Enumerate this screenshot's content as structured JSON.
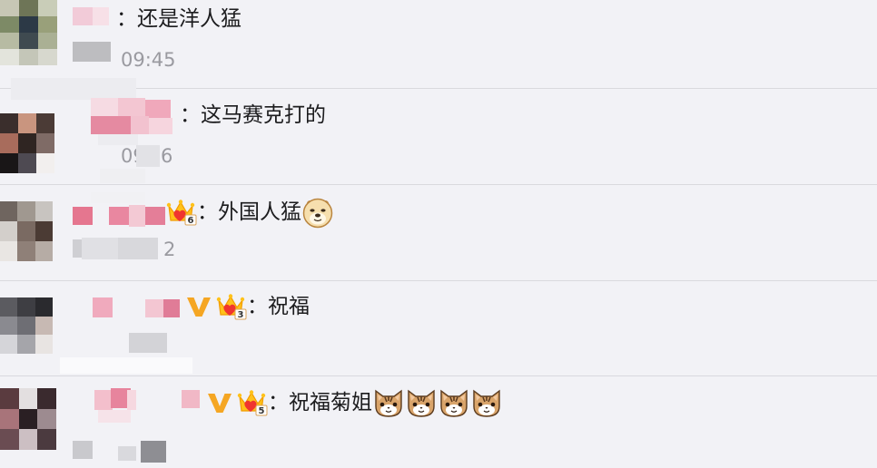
{
  "page": {
    "background": "#f2f2f6"
  },
  "colors": {
    "text": "#1c1c1e",
    "timestamp": "#9a9aa0",
    "divider": "#d9d9de",
    "verified_badge": "#f5a623",
    "fan_badge_crown": "#ffc21a",
    "fan_badge_heart": "#f0352f"
  },
  "comments": [
    {
      "text": "：还是洋人猛",
      "timestamp": "09:45"
    },
    {
      "text": "：这马赛克打的",
      "timestamp_fragments": [
        "09",
        "6"
      ]
    },
    {
      "text": "：外国人猛",
      "fan_badge_icon": "crown-heart-badge-icon",
      "fan_badge_level": "6",
      "emoji": [
        "doge-emoji"
      ],
      "timestamp_fragments": [
        "2"
      ]
    },
    {
      "text": "：祝福",
      "verified_icon": "verified-v-icon",
      "fan_badge_icon": "crown-heart-badge-icon",
      "fan_badge_level": "3"
    },
    {
      "text": "：祝福菊姐",
      "verified_icon": "verified-v-icon",
      "fan_badge_icon": "crown-heart-badge-icon",
      "fan_badge_level": "5",
      "emoji": [
        "cat-emoji",
        "cat-emoji",
        "cat-emoji",
        "cat-emoji"
      ]
    }
  ]
}
